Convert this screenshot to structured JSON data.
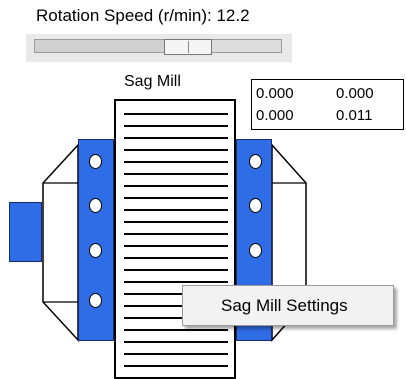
{
  "speed": {
    "label": "Rotation Speed (r/min): 12.2",
    "value_fraction": 0.62
  },
  "mill": {
    "title": "Sag Mill"
  },
  "readout": {
    "rows": [
      [
        "0.000",
        "0.000"
      ],
      [
        "0.000",
        "0.011"
      ]
    ]
  },
  "context_menu": {
    "items": [
      "Sag Mill Settings"
    ]
  },
  "colors": {
    "shell_blue": "#2f6de6",
    "outline": "#000000",
    "panel_gray": "#e9e9e9",
    "menu_background": "#f2f2f2"
  }
}
